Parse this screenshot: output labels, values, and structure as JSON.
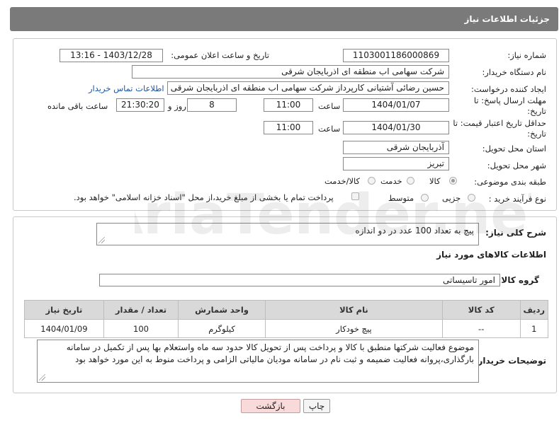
{
  "header": {
    "title": "جزئیات اطلاعات نیاز"
  },
  "need_info": {
    "need_number_label": "شماره نیاز:",
    "need_number": "1103001186000869",
    "announce_label": "تاریخ و ساعت اعلان عمومی:",
    "announce_value": "1403/12/28 - 13:16",
    "buyer_org_label": "نام دستگاه خریدار:",
    "buyer_org": "شرکت سهامی اب منطقه ای اذربایجان شرقی",
    "requester_label": "ایجاد کننده درخواست:",
    "requester": "حسین رضائی آشتیانی کارپرداز شرکت سهامی اب منطقه ای اذربایجان شرقی",
    "contact_link": "اطلاعات تماس خریدار",
    "reply_deadline_label": "مهلت ارسال پاسخ: تا تاریخ:",
    "reply_date": "1404/01/07",
    "time_label": "ساعت",
    "reply_time": "11:00",
    "days_value": "8",
    "days_label": "روز و",
    "remaining_time": "21:30:20",
    "remaining_label": "ساعت باقی مانده",
    "price_validity_label": "حداقل تاریخ اعتبار قیمت: تا تاریخ:",
    "price_date": "1404/01/30",
    "price_time": "11:00",
    "province_label": "استان محل تحویل:",
    "province": "آذربایجان شرقی",
    "city_label": "شهر محل تحویل:",
    "city": "تبریز",
    "category_label": "طبقه بندی موضوعی:",
    "category_options": [
      "کالا",
      "خدمت",
      "کالا/خدمت"
    ],
    "category_selected": "کالا",
    "process_label": "نوع فرآیند خرید :",
    "process_options": [
      "جزیی",
      "متوسط"
    ],
    "payment_note": "پرداخت تمام یا بخشی از مبلغ خرید،از محل \"اسناد خزانه اسلامی\" خواهد بود."
  },
  "details": {
    "summary_label": "شرح کلی نیاز:",
    "summary": "پیچ به تعداد 100 عدد در دو اندازه",
    "goods_info_title": "اطلاعات کالاهای مورد نیاز",
    "goods_group_label": "گروه کالا:",
    "goods_group": "امور تاسیساتی",
    "table": {
      "headers": [
        "ردیف",
        "کد کالا",
        "نام کالا",
        "واحد شمارش",
        "تعداد / مقدار",
        "تاریخ نیاز"
      ],
      "rows": [
        [
          "1",
          "--",
          "پیچ خودکار",
          "کیلوگرم",
          "100",
          "1404/01/09"
        ]
      ]
    },
    "buyer_notes_label": "توضیحات خریدار:",
    "buyer_notes": "موضوع فعالیت شرکتها منطبق با کالا و پرداخت پس از تحویل کالا حدود سه  ماه واستعلام بها پس از تکمیل در سامانه بارگذاری،پروانه فعالیت ضمیمه و ثبت نام در سامانه مودیان مالیاتی الزامی و پرداخت منوط به این مورد خواهد بود"
  },
  "buttons": {
    "print": "چاپ",
    "back": "بازگشت"
  },
  "watermark": {
    "text": "AriaTender.neT"
  },
  "colors": {
    "header_bg": "#7a7a7a",
    "link": "#1a56a8",
    "back_button": "#f8dada"
  }
}
